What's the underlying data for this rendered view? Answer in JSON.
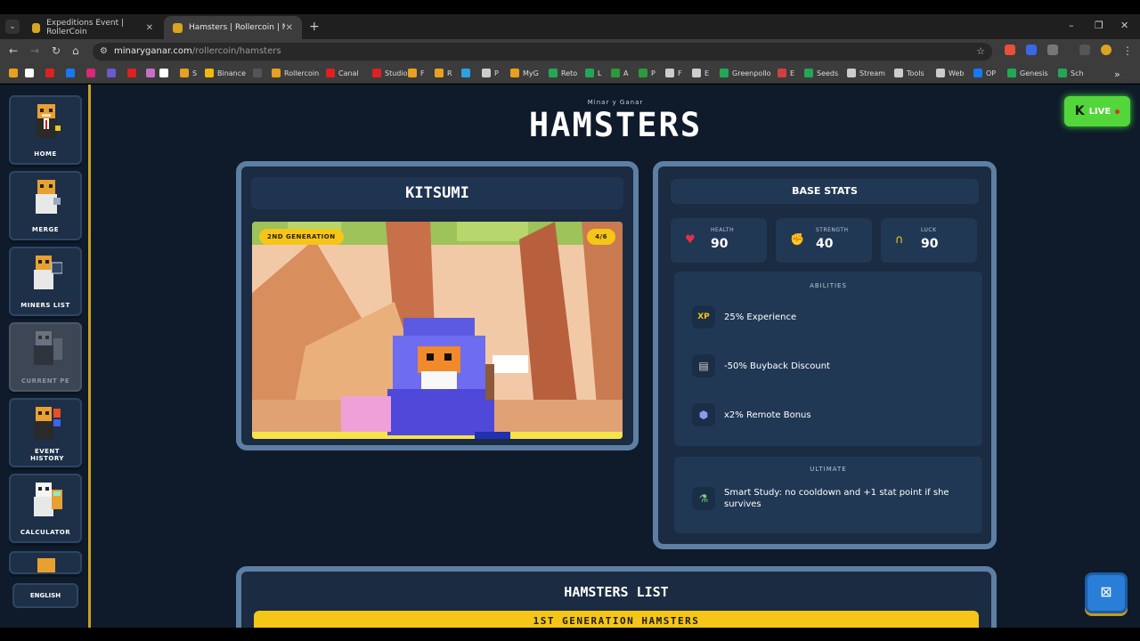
{
  "browser": {
    "tabs": [
      {
        "title": "Expeditions Event | RollerCoin",
        "active": false
      },
      {
        "title": "Hamsters | Rollercoin | Minar y",
        "active": true
      }
    ],
    "url_host": "minaryganar.com",
    "url_path": "/rollercoin/hamsters",
    "bookmarks": [
      {
        "label": "",
        "icon": "flag-icon",
        "color": "#e8a020"
      },
      {
        "label": "",
        "icon": "circle-icon",
        "color": "#ffffff"
      },
      {
        "label": "",
        "icon": "youtube-icon",
        "color": "#e02020"
      },
      {
        "label": "",
        "icon": "facebook-icon",
        "color": "#1877f2"
      },
      {
        "label": "",
        "icon": "instagram-icon",
        "color": "#d62976"
      },
      {
        "label": "",
        "icon": "twitch-icon",
        "color": "#6a5acd"
      },
      {
        "label": "",
        "icon": "youtube-icon",
        "color": "#e02020"
      },
      {
        "label": "",
        "icon": "feather-icon",
        "color": "#c86ec8"
      },
      {
        "label": "",
        "icon": "x-icon",
        "color": "#ffffff"
      },
      {
        "label": "S",
        "icon": "hamster-icon",
        "color": "#e8a020"
      },
      {
        "label": "Binance",
        "icon": "binance-icon",
        "color": "#f0b90b"
      },
      {
        "label": "",
        "icon": "tv-icon",
        "color": "#555555"
      },
      {
        "label": "Rollercoin",
        "icon": "hamster-icon",
        "color": "#e8a020"
      },
      {
        "label": "Canal",
        "icon": "youtube-icon",
        "color": "#e02020"
      },
      {
        "label": "Studio",
        "icon": "youtube-icon",
        "color": "#e02020"
      },
      {
        "label": "F",
        "icon": "hamster-icon",
        "color": "#e8a020"
      },
      {
        "label": "R",
        "icon": "hamster-icon",
        "color": "#e8a020"
      },
      {
        "label": "",
        "icon": "telegram-icon",
        "color": "#2aa3e0"
      },
      {
        "label": "P",
        "icon": "folder-icon",
        "color": "#cccccc"
      },
      {
        "label": "MyG",
        "icon": "game-icon",
        "color": "#e8a020"
      },
      {
        "label": "Reto",
        "icon": "plus-icon",
        "color": "#22a855"
      },
      {
        "label": "L",
        "icon": "circle-icon",
        "color": "#22a855"
      },
      {
        "label": "A",
        "icon": "circle-icon",
        "color": "#2c9a3c"
      },
      {
        "label": "P",
        "icon": "circle-icon",
        "color": "#2c9a3c"
      },
      {
        "label": "F",
        "icon": "gear-icon",
        "color": "#cccccc"
      },
      {
        "label": "E",
        "icon": "folder-icon",
        "color": "#cccccc"
      },
      {
        "label": "Greenpollo",
        "icon": "plus-icon",
        "color": "#22a855"
      },
      {
        "label": "E",
        "icon": "doc-icon",
        "color": "#d04040"
      },
      {
        "label": "Seeds",
        "icon": "plus-icon",
        "color": "#22a855"
      },
      {
        "label": "Stream",
        "icon": "folder-icon",
        "color": "#cccccc"
      },
      {
        "label": "Tools",
        "icon": "folder-icon",
        "color": "#cccccc"
      },
      {
        "label": "Web",
        "icon": "folder-icon",
        "color": "#cccccc"
      },
      {
        "label": "OP",
        "icon": "facebook-icon",
        "color": "#1877f2"
      },
      {
        "label": "Genesis",
        "icon": "plus-icon",
        "color": "#22a855"
      },
      {
        "label": "Sch",
        "icon": "plus-icon",
        "color": "#22a855"
      }
    ]
  },
  "sidebar": {
    "items": [
      {
        "label": "HOME",
        "state": "normal"
      },
      {
        "label": "MERGE",
        "state": "normal"
      },
      {
        "label": "MINERS LIST",
        "state": "normal"
      },
      {
        "label": "CURRENT PE",
        "state": "disabled"
      },
      {
        "label": "EVENT HISTORY",
        "state": "normal"
      },
      {
        "label": "CALCULATOR",
        "state": "normal"
      }
    ],
    "language": "ENGLISH"
  },
  "header": {
    "subtitle": "Minar y Ganar",
    "title": "HAMSTERS",
    "live_label": "LIVE"
  },
  "hamster": {
    "name": "KITSUMI",
    "generation": "2ND GENERATION",
    "count": "4/6"
  },
  "stats": {
    "title": "BASE STATS",
    "items": [
      {
        "label": "HEALTH",
        "value": "90",
        "icon": "heart-icon"
      },
      {
        "label": "STRENGTH",
        "value": "40",
        "icon": "fist-icon"
      },
      {
        "label": "LUCK",
        "value": "90",
        "icon": "horseshoe-icon"
      }
    ]
  },
  "abilities": {
    "title": "ABILITIES",
    "items": [
      {
        "text": "25% Experience",
        "icon": "xp-icon"
      },
      {
        "text": "-50% Buyback Discount",
        "icon": "receipt-icon"
      },
      {
        "text": "x2% Remote Bonus",
        "icon": "remote-icon"
      }
    ]
  },
  "ultimate": {
    "title": "ULTIMATE",
    "text": "Smart Study: no cooldown and +1 stat point if she survives",
    "icon": "potion-icon"
  },
  "list": {
    "title": "HAMSTERS LIST",
    "first_section": "1ST GENERATION HAMSTERS"
  },
  "colors": {
    "accent_yellow": "#f5c518",
    "live_green": "#52d63a",
    "card_border": "#5d7fa3",
    "page_bg": "#0f1a2a"
  }
}
